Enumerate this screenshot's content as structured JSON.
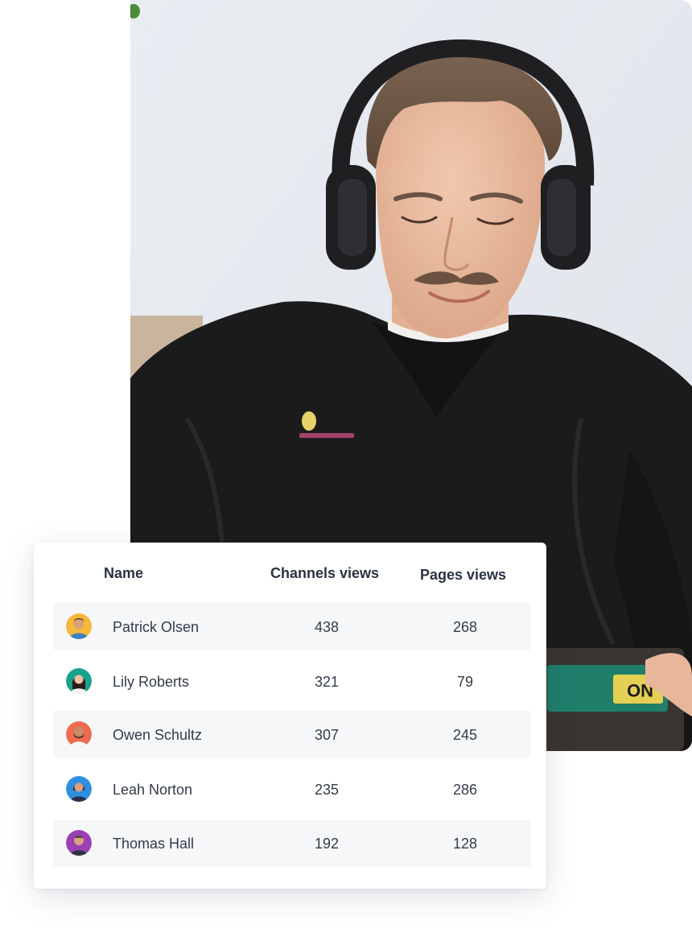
{
  "table": {
    "headers": {
      "name": "Name",
      "channels": "Channels views",
      "pages": "Pages views"
    },
    "rows": [
      {
        "name": "Patrick Olsen",
        "channels": "438",
        "pages": "268",
        "avatar_color": "#f5b73b"
      },
      {
        "name": "Lily Roberts",
        "channels": "321",
        "pages": "79",
        "avatar_color": "#1aa38b"
      },
      {
        "name": "Owen Schultz",
        "channels": "307",
        "pages": "245",
        "avatar_color": "#ef6a4f"
      },
      {
        "name": "Leah Norton",
        "channels": "235",
        "pages": "286",
        "avatar_color": "#2e8fe0"
      },
      {
        "name": "Thomas Hall",
        "channels": "192",
        "pages": "128",
        "avatar_color": "#9b3fb5"
      }
    ]
  },
  "photo": {
    "subject": "man-with-headphones",
    "colors": {
      "wall": "#e6eaef",
      "sweater": "#1b1a1b",
      "headphones": "#1f1f22"
    }
  }
}
